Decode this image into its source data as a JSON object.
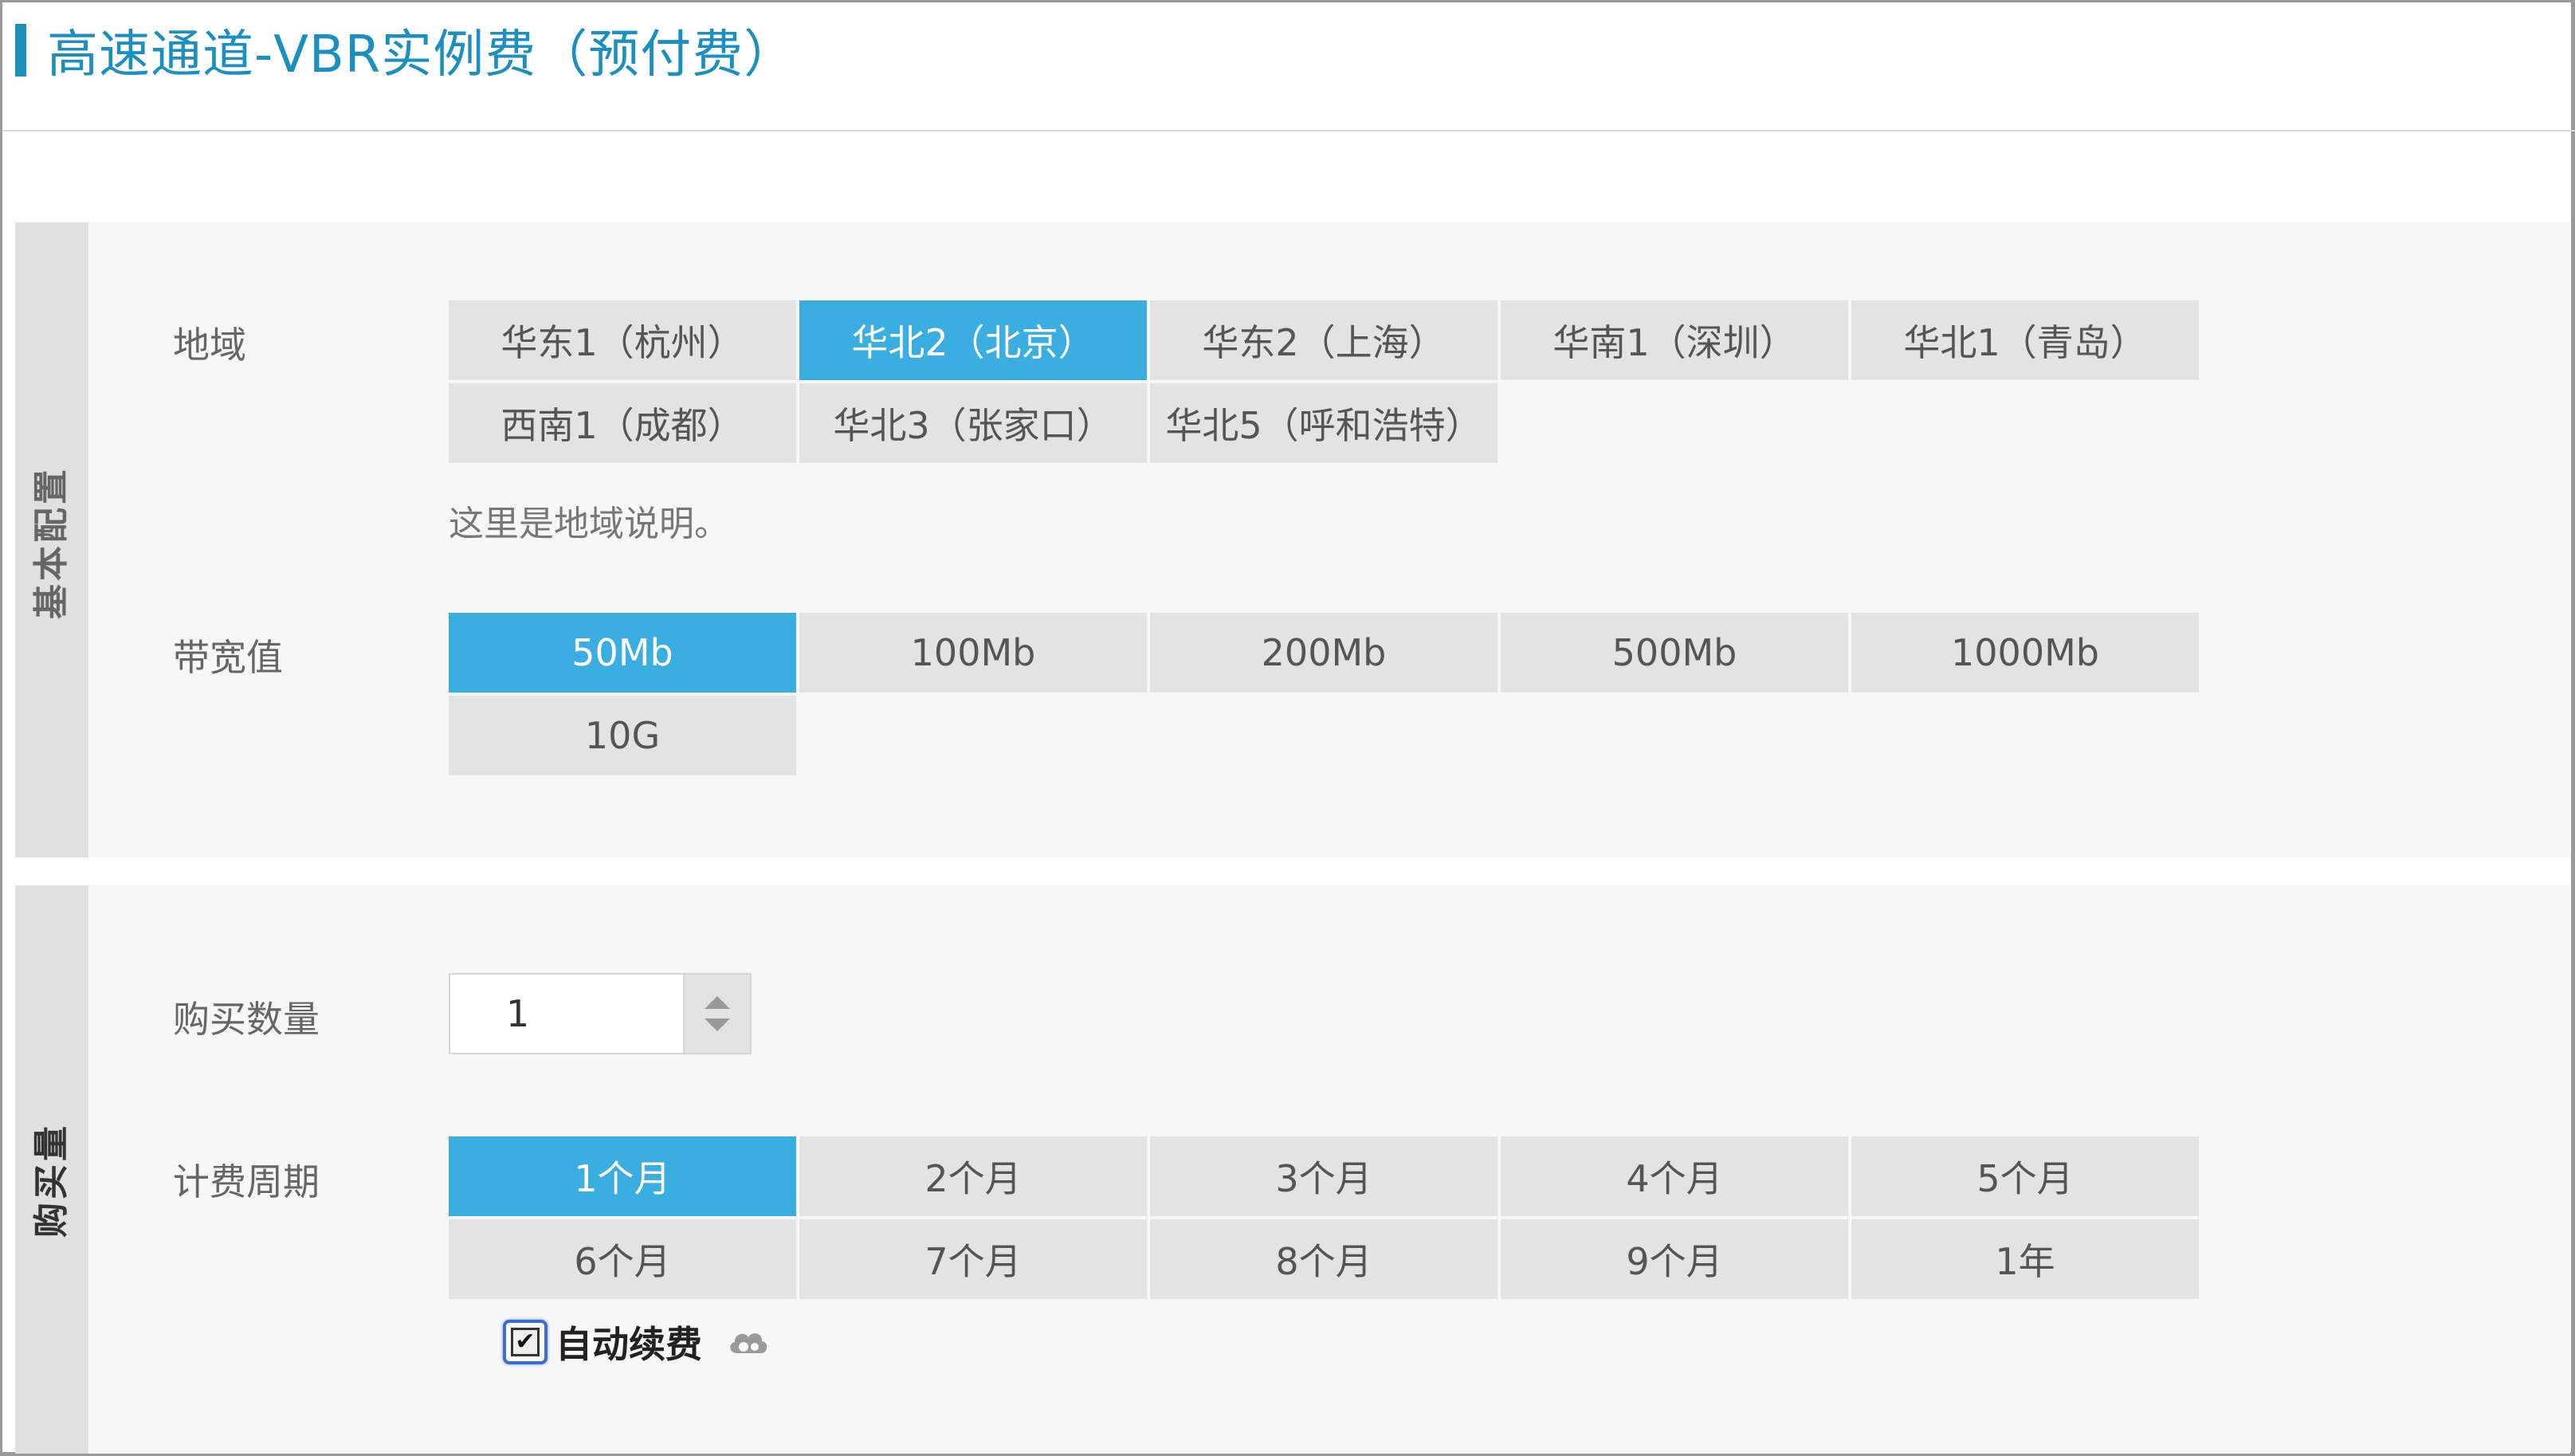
{
  "page_title": "高速通道-VBR实例费（预付费）",
  "basic_section": {
    "tab_label": "基本配置",
    "region": {
      "label": "地域",
      "options": [
        "华东1（杭州）",
        "华北2（北京）",
        "华东2（上海）",
        "华南1（深圳）",
        "华北1（青岛）",
        "西南1（成都）",
        "华北3（张家口）",
        "华北5（呼和浩特）"
      ],
      "selected": "华北2（北京）",
      "hint": "这里是地域说明。"
    },
    "bandwidth": {
      "label": "带宽值",
      "options": [
        "50Mb",
        "100Mb",
        "200Mb",
        "500Mb",
        "1000Mb",
        "10G"
      ],
      "selected": "50Mb"
    }
  },
  "purchase_section": {
    "tab_label": "购买量",
    "quantity": {
      "label": "购买数量",
      "value": "1"
    },
    "period": {
      "label": "计费周期",
      "options": [
        "1个月",
        "2个月",
        "3个月",
        "4个月",
        "5个月",
        "6个月",
        "7个月",
        "8个月",
        "9个月",
        "1年"
      ],
      "selected": "1个月"
    },
    "auto_renew": {
      "label": "自动续费",
      "checked": true,
      "icon": "cloud-icon"
    }
  },
  "colors": {
    "accent": "#1b8fc0",
    "selected": "#3aaee0",
    "option_bg": "#e3e3e3"
  }
}
